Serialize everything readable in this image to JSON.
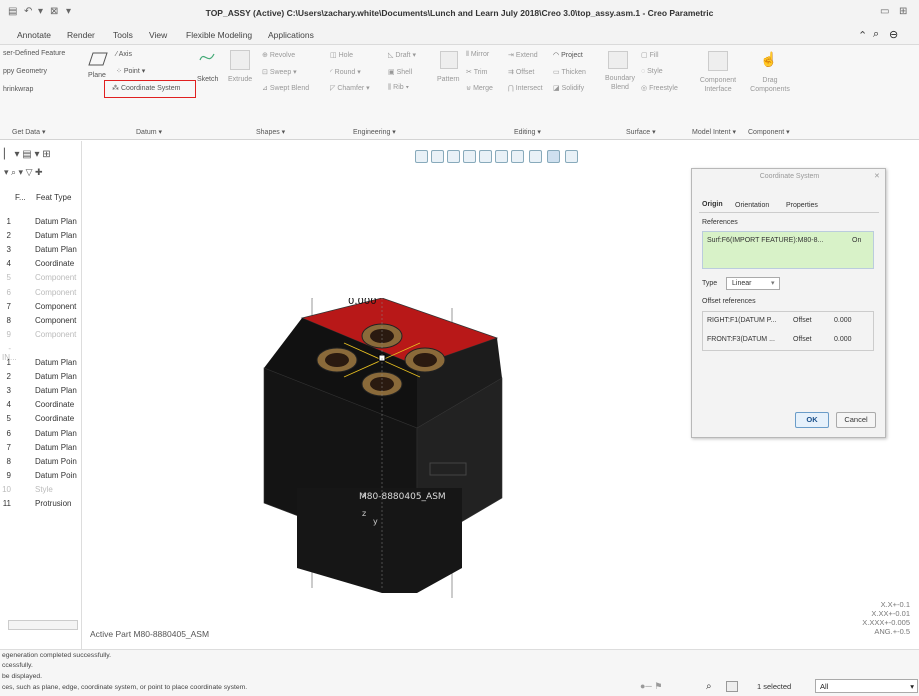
{
  "window": {
    "title": "TOP_ASSY (Active) C:\\Users\\zachary.white\\Documents\\Lunch and Learn July 2018\\Creo 3.0\\top_assy.asm.1 - Creo Parametric",
    "qa_icons": [
      "save-icon",
      "undo-icon",
      "close-window-icon",
      "dropdown-icon"
    ],
    "right_icons": [
      "minimize-icon",
      "restore-icon"
    ],
    "help_icons": [
      "up-icon",
      "search-icon",
      "help-icon"
    ]
  },
  "tabs": [
    "Annotate",
    "Render",
    "Tools",
    "View",
    "Flexible Modeling",
    "Applications"
  ],
  "ribbon": {
    "get_data": [
      "ser-Defined Feature",
      "ppy Geometry",
      "hrinkwrap"
    ],
    "datum": {
      "plane": "Plane",
      "axis": "Axis",
      "point": "Point",
      "coord": "Coordinate System",
      "sketch": "Sketch"
    },
    "shapes": {
      "extrude": "Extrude",
      "revolve": "Revolve",
      "sweep": "Sweep",
      "swept_blend": "Swept Blend"
    },
    "engineering": {
      "hole": "Hole",
      "round": "Round",
      "chamfer": "Chamfer",
      "draft": "Draft",
      "shell": "Shell",
      "rib": "Rib"
    },
    "editing": {
      "pattern": "Pattern",
      "mirror": "Mirror",
      "trim": "Trim",
      "merge": "Merge",
      "extend": "Extend",
      "offset": "Offset",
      "intersect": "Intersect",
      "project": "Project",
      "thicken": "Thicken",
      "solidify": "Solidify"
    },
    "surface": {
      "fill": "Fill",
      "boundary": "Boundary Blend",
      "style": "Style",
      "freestyle": "Freestyle"
    },
    "model_intent": {
      "component_interface": "Component Interface"
    },
    "component": {
      "drag": "Drag Components"
    },
    "groups": [
      "Get Data ▾",
      "Datum ▾",
      "Shapes ▾",
      "Engineering ▾",
      "Editing ▾",
      "Surface ▾",
      "Model Intent ▾",
      "Component ▾"
    ]
  },
  "tree": {
    "header": {
      "col1": "F...",
      "col2": "Feat Type"
    },
    "rows": [
      {
        "n": "1",
        "t": "Datum Plan",
        "dim": false
      },
      {
        "n": "2",
        "t": "Datum Plan",
        "dim": false
      },
      {
        "n": "3",
        "t": "Datum Plan",
        "dim": false
      },
      {
        "n": "4",
        "t": "Coordinate",
        "dim": false
      },
      {
        "n": "5",
        "t": "Component",
        "dim": true
      },
      {
        "n": "6",
        "t": "Component",
        "dim": true
      },
      {
        "n": "7",
        "t": "Component",
        "dim": false
      },
      {
        "n": "8",
        "t": "Component",
        "dim": false
      },
      {
        "n": "9",
        "t": "Component",
        "dim": true
      },
      {
        "n": "-IN...",
        "t": "",
        "dim": true
      },
      {
        "n": "1",
        "t": "Datum Plan",
        "dim": false
      },
      {
        "n": "2",
        "t": "Datum Plan",
        "dim": false
      },
      {
        "n": "3",
        "t": "Datum Plan",
        "dim": false
      },
      {
        "n": "4",
        "t": "Coordinate",
        "dim": false
      },
      {
        "n": "5",
        "t": "Coordinate",
        "dim": false
      },
      {
        "n": "6",
        "t": "Datum Plan",
        "dim": false
      },
      {
        "n": "7",
        "t": "Datum Plan",
        "dim": false
      },
      {
        "n": "8",
        "t": "Datum Poin",
        "dim": false
      },
      {
        "n": "9",
        "t": "Datum Poin",
        "dim": false
      },
      {
        "n": "10",
        "t": "Style",
        "dim": true
      },
      {
        "n": "11",
        "t": "Protrusion",
        "dim": false
      }
    ]
  },
  "canvas": {
    "dim_value": "0.000",
    "model_label": "M80-8880405_ASM",
    "active_part": "Active Part M80-8880405_ASM",
    "axis_x": "x",
    "axis_y": "y",
    "axis_z": "z",
    "tolerances": [
      "X.X+-0.1",
      "X.XX+-0.01",
      "X.XXX+-0.005",
      "ANG.+-0.5"
    ]
  },
  "dialog": {
    "title": "Coordinate System",
    "tabs": [
      "Origin",
      "Orientation",
      "Properties"
    ],
    "references_label": "References",
    "ref_item": "Surf:F6(IMPORT FEATURE):M80-8...",
    "ref_status": "On",
    "type_label": "Type",
    "type_value": "Linear",
    "offset_label": "Offset references",
    "offsets": [
      {
        "ref": "RIGHT:F1(DATUM P...",
        "type": "Offset",
        "val": "0.000"
      },
      {
        "ref": "FRONT:F3(DATUM ...",
        "type": "Offset",
        "val": "0.000"
      }
    ],
    "ok": "OK",
    "cancel": "Cancel"
  },
  "status": {
    "lines": [
      "egeneration completed successfully.",
      "ccessfully.",
      "be displayed.",
      "ces, such as plane, edge, coordinate system, or point to place coordinate system."
    ],
    "selected": "1 selected",
    "filter": "All"
  },
  "colors": {
    "model_body": "#141414",
    "model_top": "#b81818",
    "rings": "#8a6a3a",
    "highlight": "#e02020"
  }
}
